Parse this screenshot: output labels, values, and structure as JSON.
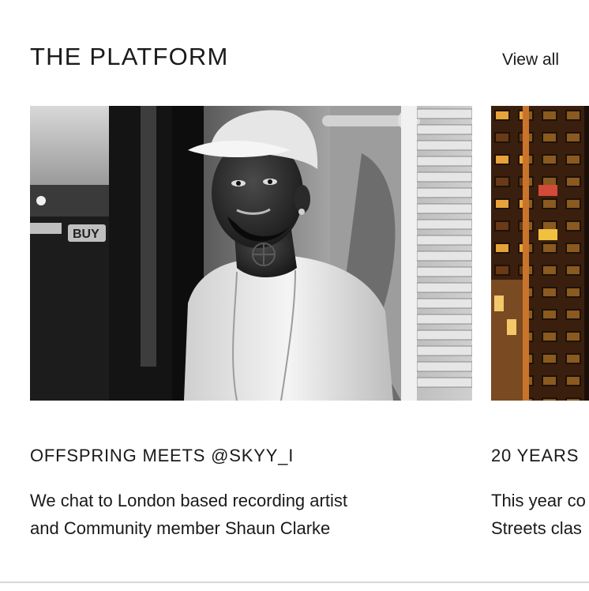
{
  "section": {
    "title": "THE PLATFORM",
    "view_all_label": "View all"
  },
  "cards": [
    {
      "title": "OFFSPRING MEETS @SKYY_I",
      "description_line1": "We chat to London based recording artist",
      "description_line2": "and Community member Shaun Clarke",
      "image_alt": "Black and white portrait of a man in a white cap and t-shirt"
    },
    {
      "title": "20 YEARS",
      "description_line1": "This year co",
      "description_line2": "Streets clas",
      "image_alt": "Night view of a tower block with lit windows"
    }
  ],
  "sign_text": "BUY"
}
